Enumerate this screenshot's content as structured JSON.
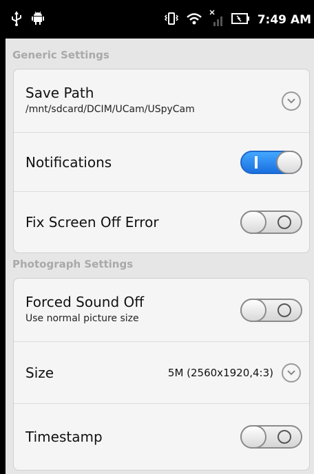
{
  "status_bar": {
    "time": "7:49 AM",
    "icons": [
      "usb-icon",
      "android-icon",
      "vibrate-icon",
      "wifi-icon",
      "no-signal-icon",
      "battery-icon"
    ]
  },
  "sections": {
    "generic": {
      "header": "Generic Settings",
      "save_path": {
        "title": "Save Path",
        "subtitle": "/mnt/sdcard/DCIM/UCam/USpyCam"
      },
      "notifications": {
        "title": "Notifications",
        "state": "on"
      },
      "fix_screen": {
        "title": "Fix Screen Off Error",
        "state": "off"
      }
    },
    "photograph": {
      "header": "Photograph Settings",
      "forced_sound": {
        "title": "Forced Sound Off",
        "subtitle": "Use normal picture size",
        "state": "off"
      },
      "size": {
        "title": "Size",
        "value": "5M (2560x1920,4:3)"
      },
      "timestamp": {
        "title": "Timestamp",
        "state": "off"
      }
    }
  },
  "colors": {
    "toggle_on": "#2a86f0",
    "section_header": "#a9a9a9",
    "background": "#e6e6e6"
  }
}
